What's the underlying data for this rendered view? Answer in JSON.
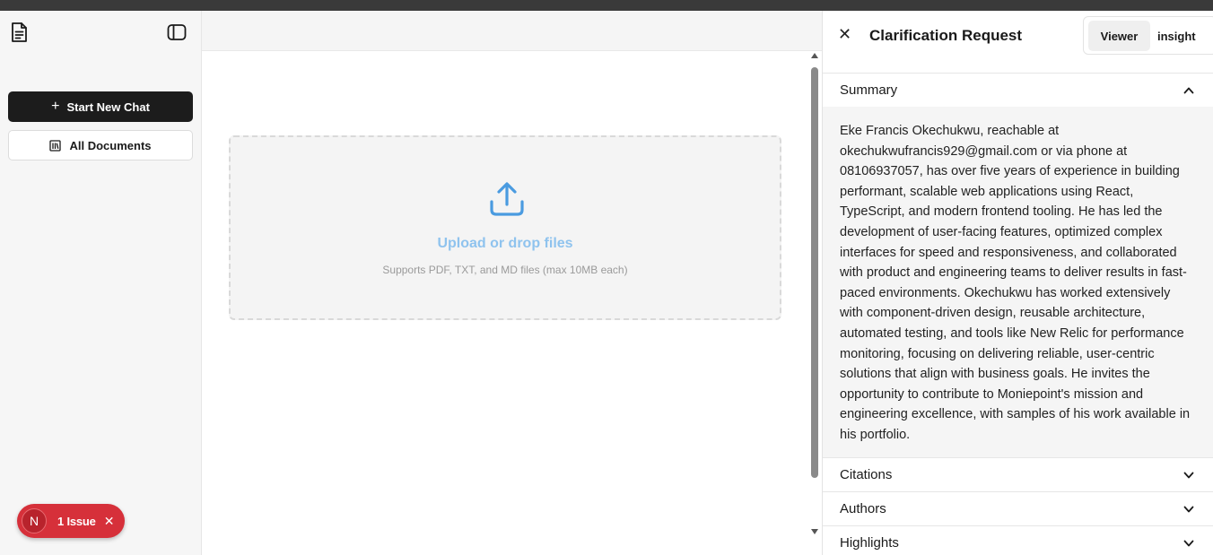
{
  "sidebar": {
    "doc_icon": "document-icon",
    "toggle_icon": "panel-toggle-icon",
    "new_chat_icon": "plus-icon",
    "new_chat_label": "Start New Chat",
    "all_docs_icon": "library-icon",
    "all_docs_label": "All Documents"
  },
  "issue_badge": {
    "avatar_letter": "N",
    "label": "1 Issue",
    "close_icon": "close-icon"
  },
  "upload": {
    "icon": "upload-icon",
    "title": "Upload or drop files",
    "subtitle": "Supports PDF, TXT, and MD files (max 10MB each)"
  },
  "panel": {
    "close_icon": "close-icon",
    "title": "Clarification Request",
    "tabs": [
      {
        "label": "Viewer",
        "active": true
      },
      {
        "label": "insight",
        "active": false
      }
    ],
    "sections": [
      {
        "label": "Summary",
        "expanded": true,
        "body": "Eke Francis Okechukwu, reachable at okechukwufrancis929@gmail.com or via phone at 08106937057, has over five years of experience in building performant, scalable web applications using React, TypeScript, and modern frontend tooling. He has led the development of user-facing features, optimized complex interfaces for speed and responsiveness, and collaborated with product and engineering teams to deliver results in fast-paced environments. Okechukwu has worked extensively with component-driven design, reusable architecture, automated testing, and tools like New Relic for performance monitoring, focusing on delivering reliable, user-centric solutions that align with business goals. He invites the opportunity to contribute to Moniepoint's mission and engineering excellence, with samples of his work available in his portfolio."
      },
      {
        "label": "Citations",
        "expanded": false
      },
      {
        "label": "Authors",
        "expanded": false
      },
      {
        "label": "Highlights",
        "expanded": false
      }
    ]
  },
  "colors": {
    "primary_button": "#1c1c1c",
    "upload_accent": "#4a9be0",
    "issue_red": "#d6303a",
    "topbar": "#3a3a3a"
  }
}
